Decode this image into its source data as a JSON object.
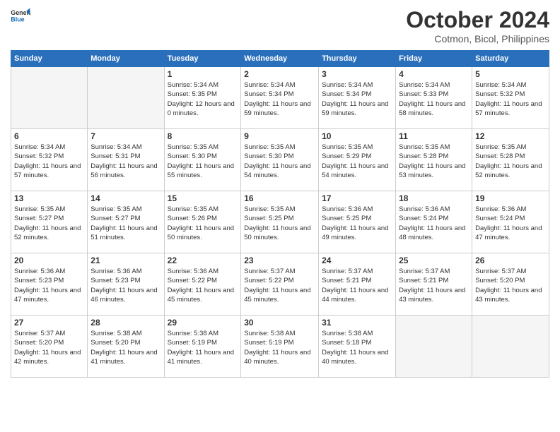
{
  "logo": {
    "line1": "General",
    "line2": "Blue"
  },
  "title": "October 2024",
  "subtitle": "Cotmon, Bicol, Philippines",
  "days_of_week": [
    "Sunday",
    "Monday",
    "Tuesday",
    "Wednesday",
    "Thursday",
    "Friday",
    "Saturday"
  ],
  "weeks": [
    [
      {
        "day": "",
        "empty": true
      },
      {
        "day": "",
        "empty": true
      },
      {
        "day": "1",
        "sunrise": "Sunrise: 5:34 AM",
        "sunset": "Sunset: 5:35 PM",
        "daylight": "Daylight: 12 hours and 0 minutes."
      },
      {
        "day": "2",
        "sunrise": "Sunrise: 5:34 AM",
        "sunset": "Sunset: 5:34 PM",
        "daylight": "Daylight: 11 hours and 59 minutes."
      },
      {
        "day": "3",
        "sunrise": "Sunrise: 5:34 AM",
        "sunset": "Sunset: 5:34 PM",
        "daylight": "Daylight: 11 hours and 59 minutes."
      },
      {
        "day": "4",
        "sunrise": "Sunrise: 5:34 AM",
        "sunset": "Sunset: 5:33 PM",
        "daylight": "Daylight: 11 hours and 58 minutes."
      },
      {
        "day": "5",
        "sunrise": "Sunrise: 5:34 AM",
        "sunset": "Sunset: 5:32 PM",
        "daylight": "Daylight: 11 hours and 57 minutes."
      }
    ],
    [
      {
        "day": "6",
        "sunrise": "Sunrise: 5:34 AM",
        "sunset": "Sunset: 5:32 PM",
        "daylight": "Daylight: 11 hours and 57 minutes."
      },
      {
        "day": "7",
        "sunrise": "Sunrise: 5:34 AM",
        "sunset": "Sunset: 5:31 PM",
        "daylight": "Daylight: 11 hours and 56 minutes."
      },
      {
        "day": "8",
        "sunrise": "Sunrise: 5:35 AM",
        "sunset": "Sunset: 5:30 PM",
        "daylight": "Daylight: 11 hours and 55 minutes."
      },
      {
        "day": "9",
        "sunrise": "Sunrise: 5:35 AM",
        "sunset": "Sunset: 5:30 PM",
        "daylight": "Daylight: 11 hours and 54 minutes."
      },
      {
        "day": "10",
        "sunrise": "Sunrise: 5:35 AM",
        "sunset": "Sunset: 5:29 PM",
        "daylight": "Daylight: 11 hours and 54 minutes."
      },
      {
        "day": "11",
        "sunrise": "Sunrise: 5:35 AM",
        "sunset": "Sunset: 5:28 PM",
        "daylight": "Daylight: 11 hours and 53 minutes."
      },
      {
        "day": "12",
        "sunrise": "Sunrise: 5:35 AM",
        "sunset": "Sunset: 5:28 PM",
        "daylight": "Daylight: 11 hours and 52 minutes."
      }
    ],
    [
      {
        "day": "13",
        "sunrise": "Sunrise: 5:35 AM",
        "sunset": "Sunset: 5:27 PM",
        "daylight": "Daylight: 11 hours and 52 minutes."
      },
      {
        "day": "14",
        "sunrise": "Sunrise: 5:35 AM",
        "sunset": "Sunset: 5:27 PM",
        "daylight": "Daylight: 11 hours and 51 minutes."
      },
      {
        "day": "15",
        "sunrise": "Sunrise: 5:35 AM",
        "sunset": "Sunset: 5:26 PM",
        "daylight": "Daylight: 11 hours and 50 minutes."
      },
      {
        "day": "16",
        "sunrise": "Sunrise: 5:35 AM",
        "sunset": "Sunset: 5:25 PM",
        "daylight": "Daylight: 11 hours and 50 minutes."
      },
      {
        "day": "17",
        "sunrise": "Sunrise: 5:36 AM",
        "sunset": "Sunset: 5:25 PM",
        "daylight": "Daylight: 11 hours and 49 minutes."
      },
      {
        "day": "18",
        "sunrise": "Sunrise: 5:36 AM",
        "sunset": "Sunset: 5:24 PM",
        "daylight": "Daylight: 11 hours and 48 minutes."
      },
      {
        "day": "19",
        "sunrise": "Sunrise: 5:36 AM",
        "sunset": "Sunset: 5:24 PM",
        "daylight": "Daylight: 11 hours and 47 minutes."
      }
    ],
    [
      {
        "day": "20",
        "sunrise": "Sunrise: 5:36 AM",
        "sunset": "Sunset: 5:23 PM",
        "daylight": "Daylight: 11 hours and 47 minutes."
      },
      {
        "day": "21",
        "sunrise": "Sunrise: 5:36 AM",
        "sunset": "Sunset: 5:23 PM",
        "daylight": "Daylight: 11 hours and 46 minutes."
      },
      {
        "day": "22",
        "sunrise": "Sunrise: 5:36 AM",
        "sunset": "Sunset: 5:22 PM",
        "daylight": "Daylight: 11 hours and 45 minutes."
      },
      {
        "day": "23",
        "sunrise": "Sunrise: 5:37 AM",
        "sunset": "Sunset: 5:22 PM",
        "daylight": "Daylight: 11 hours and 45 minutes."
      },
      {
        "day": "24",
        "sunrise": "Sunrise: 5:37 AM",
        "sunset": "Sunset: 5:21 PM",
        "daylight": "Daylight: 11 hours and 44 minutes."
      },
      {
        "day": "25",
        "sunrise": "Sunrise: 5:37 AM",
        "sunset": "Sunset: 5:21 PM",
        "daylight": "Daylight: 11 hours and 43 minutes."
      },
      {
        "day": "26",
        "sunrise": "Sunrise: 5:37 AM",
        "sunset": "Sunset: 5:20 PM",
        "daylight": "Daylight: 11 hours and 43 minutes."
      }
    ],
    [
      {
        "day": "27",
        "sunrise": "Sunrise: 5:37 AM",
        "sunset": "Sunset: 5:20 PM",
        "daylight": "Daylight: 11 hours and 42 minutes."
      },
      {
        "day": "28",
        "sunrise": "Sunrise: 5:38 AM",
        "sunset": "Sunset: 5:20 PM",
        "daylight": "Daylight: 11 hours and 41 minutes."
      },
      {
        "day": "29",
        "sunrise": "Sunrise: 5:38 AM",
        "sunset": "Sunset: 5:19 PM",
        "daylight": "Daylight: 11 hours and 41 minutes."
      },
      {
        "day": "30",
        "sunrise": "Sunrise: 5:38 AM",
        "sunset": "Sunset: 5:19 PM",
        "daylight": "Daylight: 11 hours and 40 minutes."
      },
      {
        "day": "31",
        "sunrise": "Sunrise: 5:38 AM",
        "sunset": "Sunset: 5:18 PM",
        "daylight": "Daylight: 11 hours and 40 minutes."
      },
      {
        "day": "",
        "empty": true
      },
      {
        "day": "",
        "empty": true
      }
    ]
  ]
}
